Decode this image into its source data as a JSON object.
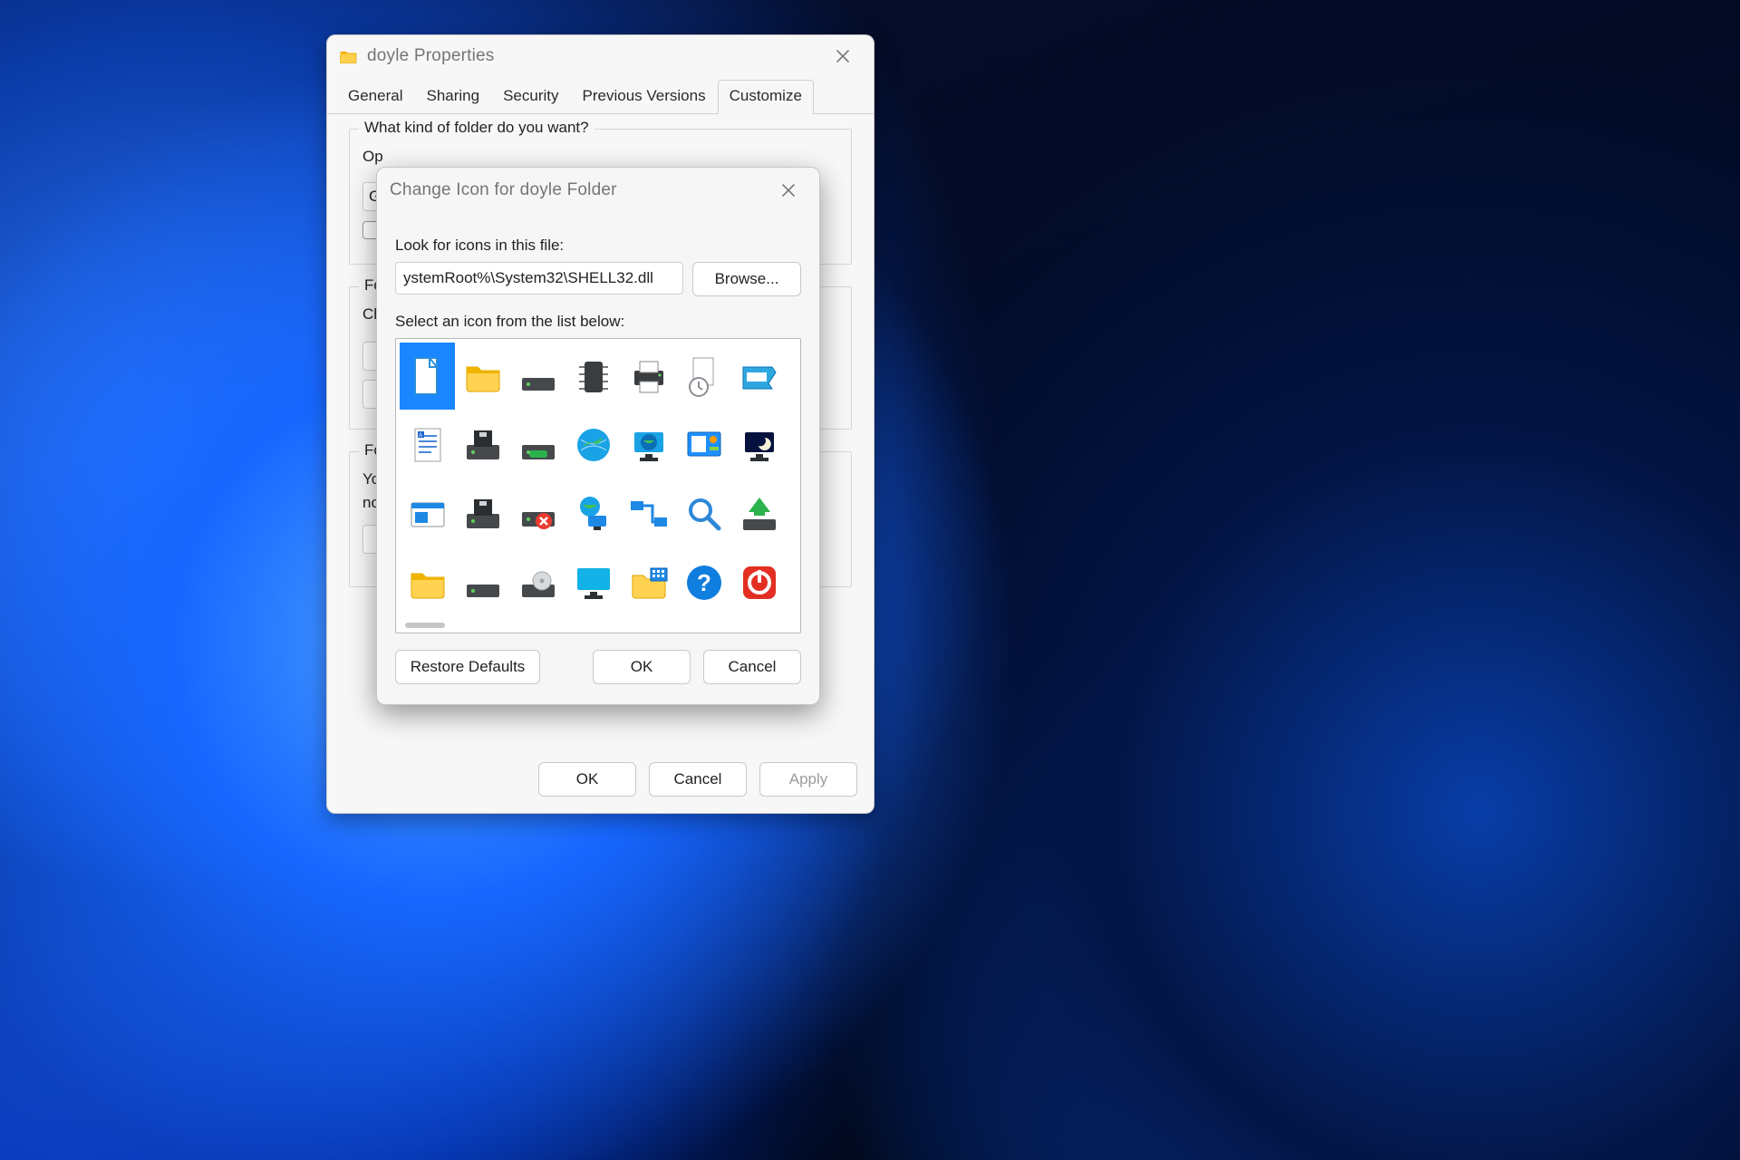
{
  "properties_window": {
    "title": "doyle Properties",
    "tabs": [
      "General",
      "Sharing",
      "Security",
      "Previous Versions",
      "Customize"
    ],
    "active_tab": "Customize",
    "groups": {
      "folder_kind": {
        "legend": "What kind of folder do you want?",
        "line1_prefix": "Op",
        "dropdown_prefix": "G"
      },
      "folder_pics": {
        "legend_prefix": "Fol",
        "line1_prefix": "Ch"
      },
      "folder_icons": {
        "legend_prefix": "Fol",
        "line1_prefix": "Yo",
        "line2_prefix": "no"
      }
    },
    "buttons": {
      "ok": "OK",
      "cancel": "Cancel",
      "apply": "Apply"
    }
  },
  "change_icon_dialog": {
    "title": "Change Icon for doyle Folder",
    "look_label": "Look for icons in this file:",
    "path_value": "ystemRoot%\\System32\\SHELL32.dll",
    "browse": "Browse...",
    "select_label": "Select an icon from the list below:",
    "buttons": {
      "restore": "Restore Defaults",
      "ok": "OK",
      "cancel": "Cancel"
    },
    "selected_index": 0,
    "icons": [
      "blank-document-icon",
      "folder-icon",
      "drive-icon",
      "chip-icon",
      "printer-icon",
      "recent-document-icon",
      "run-icon",
      "text-document-icon",
      "floppy-drive-icon",
      "removable-drive-icon",
      "globe-icon",
      "network-monitor-icon",
      "control-panel-icon",
      "screensaver-icon",
      "program-window-icon",
      "floppy-drive-icon-2",
      "drive-error-icon",
      "network-globe-icon",
      "network-connect-icon",
      "search-icon",
      "eject-drive-icon",
      "folder-icon-2",
      "drive-icon-2",
      "optical-drive-icon",
      "monitor-icon",
      "folder-options-icon",
      "help-icon",
      "shutdown-icon"
    ]
  }
}
